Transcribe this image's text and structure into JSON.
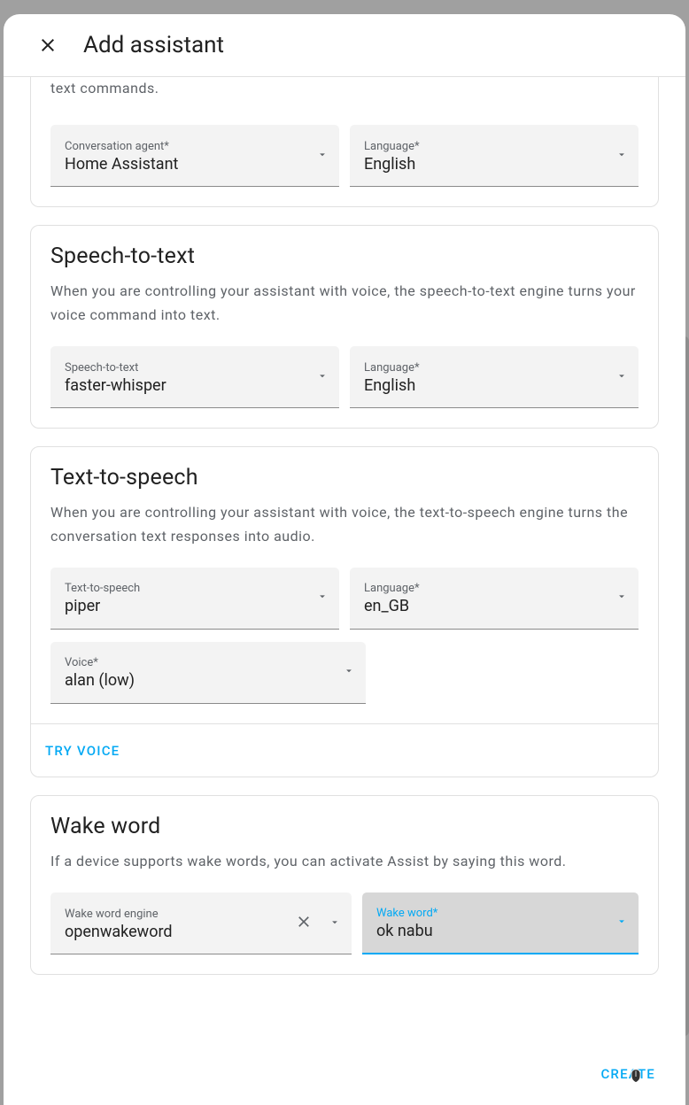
{
  "header": {
    "title": "Add assistant"
  },
  "intro": {
    "trailing_text": "text commands.",
    "conversation_agent": {
      "label": "Conversation agent*",
      "value": "Home Assistant"
    },
    "language": {
      "label": "Language*",
      "value": "English"
    }
  },
  "stt": {
    "title": "Speech-to-text",
    "desc": "When you are controlling your assistant with voice, the speech-to-text engine turns your voice command into text.",
    "engine": {
      "label": "Speech-to-text",
      "value": "faster-whisper"
    },
    "language": {
      "label": "Language*",
      "value": "English"
    }
  },
  "tts": {
    "title": "Text-to-speech",
    "desc": "When you are controlling your assistant with voice, the text-to-speech engine turns the conversation text responses into audio.",
    "engine": {
      "label": "Text-to-speech",
      "value": "piper"
    },
    "language": {
      "label": "Language*",
      "value": "en_GB"
    },
    "voice": {
      "label": "Voice*",
      "value": "alan (low)"
    },
    "try_voice": "TRY VOICE"
  },
  "wake": {
    "title": "Wake word",
    "desc": "If a device supports wake words, you can activate Assist by saying this word.",
    "engine": {
      "label": "Wake word engine",
      "value": "openwakeword"
    },
    "word": {
      "label": "Wake word*",
      "value": "ok nabu"
    }
  },
  "footer": {
    "create": "CREATE"
  }
}
